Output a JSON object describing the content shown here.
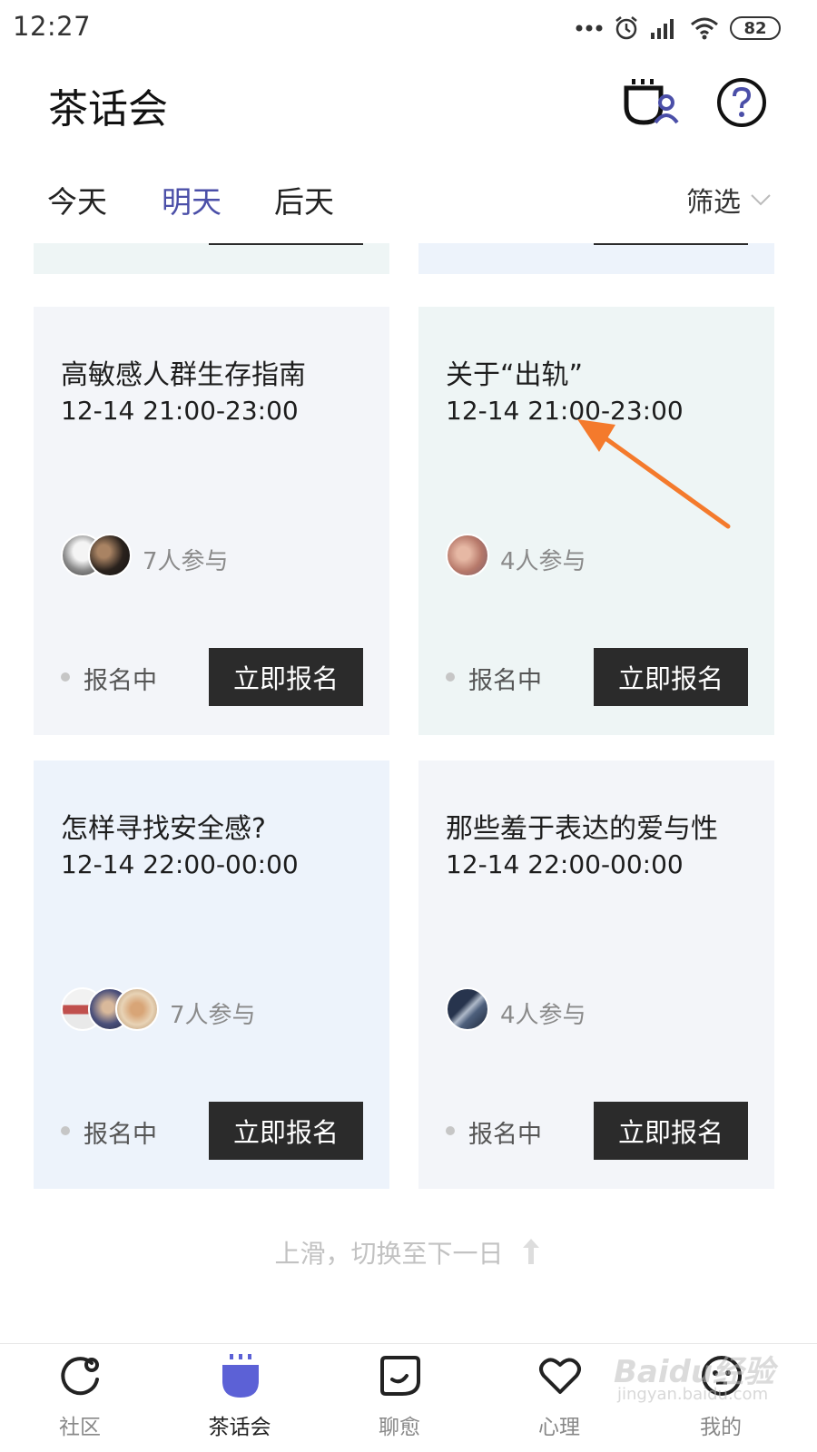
{
  "status_bar": {
    "time": "12:27",
    "battery": "82"
  },
  "header": {
    "title": "茶话会",
    "icons": [
      "tea-room-profile-icon",
      "help-icon"
    ]
  },
  "tabs": [
    {
      "label": "今天",
      "active": false
    },
    {
      "label": "明天",
      "active": true
    },
    {
      "label": "后天",
      "active": false
    }
  ],
  "filter": {
    "label": "筛选",
    "icon": "chevron-down-icon"
  },
  "cards": [
    {
      "title": "高敏感人群生存指南",
      "time": "12-14 21:00-23:00",
      "participants": "7人参与",
      "status": "报名中",
      "button": "立即报名",
      "bg": "#f3f5f9"
    },
    {
      "title": "关于“出轨”",
      "time": "12-14 21:00-23:00",
      "participants": "4人参与",
      "status": "报名中",
      "button": "立即报名",
      "bg": "#eef5f5"
    },
    {
      "title": "怎样寻找安全感?",
      "time": "12-14 22:00-00:00",
      "participants": "7人参与",
      "status": "报名中",
      "button": "立即报名",
      "bg": "#edf3fb"
    },
    {
      "title": "那些羞于表达的爱与性",
      "time": "12-14 22:00-00:00",
      "participants": "4人参与",
      "status": "报名中",
      "button": "立即报名",
      "bg": "#f3f5f9"
    }
  ],
  "hint": "上滑，切换至下一日",
  "bottom_nav": [
    {
      "label": "社区",
      "icon": "community-icon",
      "active": false
    },
    {
      "label": "茶话会",
      "icon": "tea-cup-icon",
      "active": true
    },
    {
      "label": "聊愈",
      "icon": "chat-icon",
      "active": false
    },
    {
      "label": "心理",
      "icon": "heart-icon",
      "active": false
    },
    {
      "label": "我的",
      "icon": "profile-face-icon",
      "active": false
    }
  ],
  "watermark": {
    "brand": "Baidu经验",
    "url": "jingyan.baidu.com"
  },
  "colors": {
    "accent": "#4b4fa8",
    "arrow": "#f47a2c",
    "button": "#2b2b2b",
    "nav_active": "#5c61d6"
  }
}
